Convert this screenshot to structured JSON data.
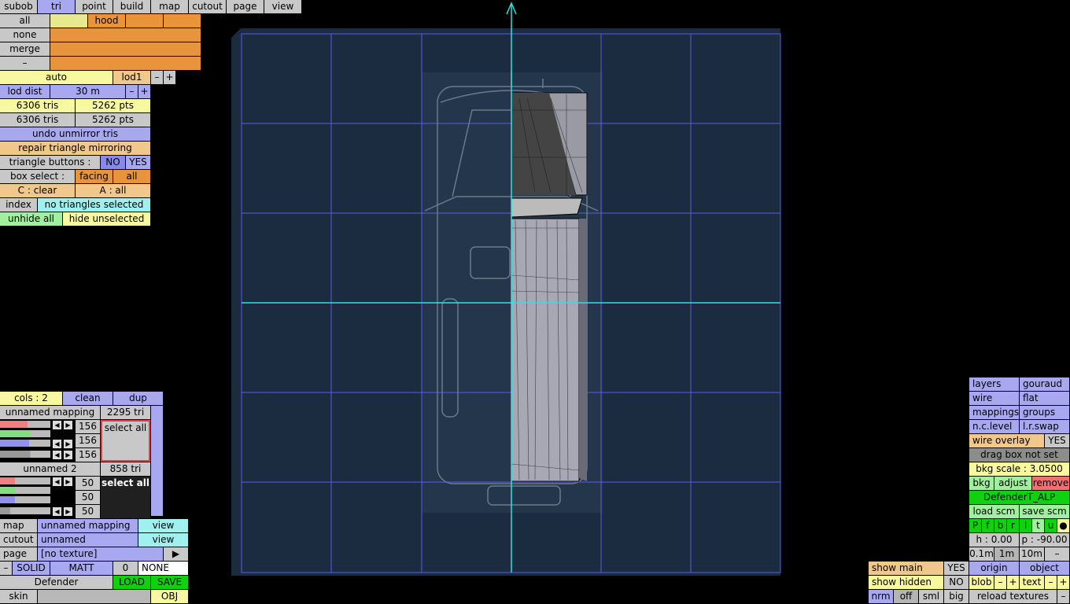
{
  "top_tabs": [
    "subob",
    "tri",
    "point",
    "build",
    "map",
    "cutout",
    "page",
    "view"
  ],
  "hood": {
    "all": "all",
    "hood": "hood",
    "none": "none",
    "merge": "merge",
    "dash": "–"
  },
  "lod": {
    "auto": "auto",
    "lod1": "lod1",
    "minus": "–",
    "plus": "+",
    "dist_label": "lod dist",
    "dist_value": "30 m"
  },
  "stats": {
    "tris1": "6306 tris",
    "pts1": "5262 pts",
    "tris2": "6306 tris",
    "pts2": "5262 pts"
  },
  "tri_tools": {
    "undo": "undo unmirror tris",
    "repair": "repair triangle mirroring",
    "tri_buttons": "triangle buttons :",
    "no": "NO",
    "yes": "YES",
    "box_select": "box select :",
    "facing": "facing",
    "all": "all",
    "c_clear": "C : clear",
    "a_all": "A : all",
    "index": "index",
    "no_selected": "no triangles selected",
    "unhide": "unhide all",
    "hide_unsel": "hide unselected"
  },
  "mapping": {
    "cols": "cols : 2",
    "clean": "clean",
    "dup": "dup",
    "m1_name": "unnamed mapping",
    "m1_tri": "2295 tri",
    "m1_vals": [
      "156",
      "156",
      "156"
    ],
    "select_all": "select all",
    "m2_name": "unnamed 2",
    "m2_tri": "858 tri",
    "m2_vals": [
      "50",
      "50",
      "50"
    ]
  },
  "assign": {
    "map": "map",
    "map_val": "unnamed mapping",
    "view": "view",
    "cutout": "cutout",
    "cutout_val": "unnamed",
    "page": "page",
    "page_val": "[no texture]",
    "arrow": "▶",
    "minus": "–",
    "solid": "SOLID",
    "matt": "MATT",
    "zero": "0",
    "none": "NONE",
    "model": "Defender",
    "load": "LOAD",
    "save": "SAVE",
    "skin": "skin",
    "obj": "OBJ"
  },
  "right_panel": {
    "layers": "layers",
    "gouraud": "gouraud",
    "wire": "wire",
    "flat": "flat",
    "mappings": "mappings",
    "groups": "groups",
    "nclevel": "n.c.level",
    "lrswap": "l.r.swap",
    "wire_overlay": "wire overlay",
    "yes": "YES",
    "drag_box": "drag box not set",
    "bkg_scale": "bkg scale : 3.0500",
    "bkg": "bkg",
    "adjust": "adjust",
    "remove": "remove",
    "bkg_name": "DefenderT_ALP",
    "load_scm": "load scm",
    "save_scm": "save scm",
    "view_letters": [
      "P",
      "f",
      "b",
      "r",
      "l",
      "t",
      "u",
      "●"
    ],
    "h": "h : 0.00",
    "p": "p : -90.00",
    "s01": "0.1m",
    "s1": "1m",
    "s10": "10m",
    "dash": "–",
    "origin": "origin",
    "object": "object",
    "blob": "blob",
    "minus": "–",
    "plus": "+",
    "text": "text",
    "reload": "reload textures"
  },
  "bottom_left": {
    "show_main": "show main",
    "yes": "YES",
    "show_hidden": "show hidden",
    "no": "NO",
    "nrm": "nrm",
    "off": "off",
    "sml": "sml",
    "big": "big"
  }
}
